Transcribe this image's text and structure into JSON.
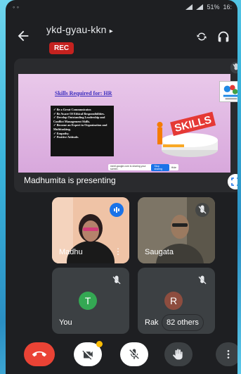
{
  "status_bar": {
    "time": "16:",
    "battery": "51%"
  },
  "meeting": {
    "title": "ykd-gyau-kkn",
    "rec_label": "REC"
  },
  "presentation": {
    "heading": "Skills Required for: HR",
    "bullets": [
      "Be a Great Communicator.",
      "Be Aware Of Ethical Responsibilities.",
      "Develop Outstanding Leadership and Conflict Management Skills.",
      "Become an Expert in Organization and Multitasking.",
      "Empathy.",
      "Positive Attitude."
    ],
    "art_text": "SKILLS",
    "presenting_label": "Madhumita  is presenting"
  },
  "participants": [
    {
      "name": "Madhu",
      "speaking": true
    },
    {
      "name": "Saugata",
      "muted": true
    },
    {
      "name": "You",
      "initial": "T",
      "avatar_color": "#34a853",
      "muted": true
    },
    {
      "name": "Rak",
      "initial": "R",
      "avatar_color": "#8d4d3f",
      "muted": true
    }
  ],
  "others_label": "82 others",
  "colors": {
    "rec": "#c5221f",
    "end_call": "#ea4335",
    "speaking": "#1a73e8"
  }
}
